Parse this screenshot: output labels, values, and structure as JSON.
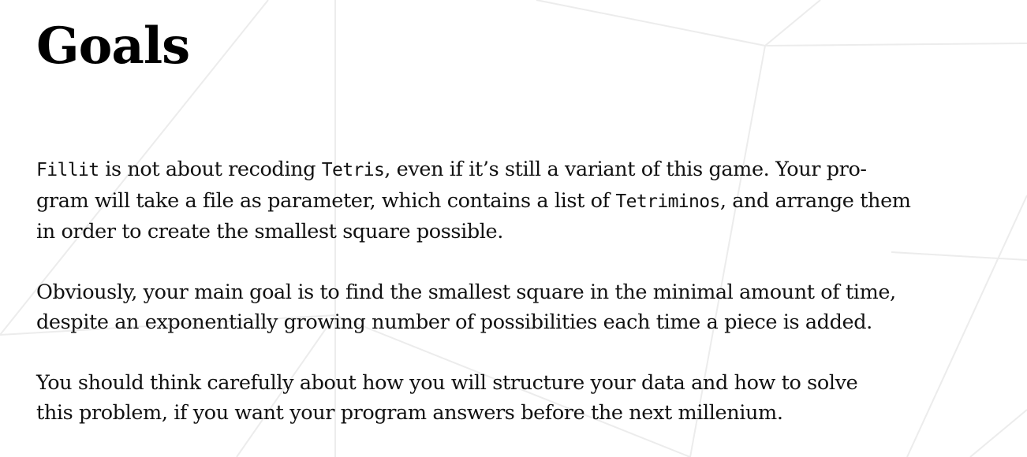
{
  "title": "Goals",
  "paragraph1": {
    "code_fillit": "Fillit",
    "t1": " is not about recoding ",
    "code_tetris": "Tetris",
    "t2": ", even if it’s still a variant of this game. Your pro-",
    "t3": "gram will take a file as parameter, which contains a list of ",
    "code_tetriminos": "Tetriminos",
    "t4": ", and arrange them",
    "t5": "in order to create the smallest square possible."
  },
  "paragraph2": {
    "line1": "Obviously, your main goal is to find the smallest square in the minimal amount of time,",
    "line2": "despite an exponentially growing number of possibilities each time a piece is added."
  },
  "paragraph3": {
    "line1": "You should think carefully about how you will structure your data and how to solve",
    "line2": "this problem, if you want your program answers before the next millenium."
  }
}
